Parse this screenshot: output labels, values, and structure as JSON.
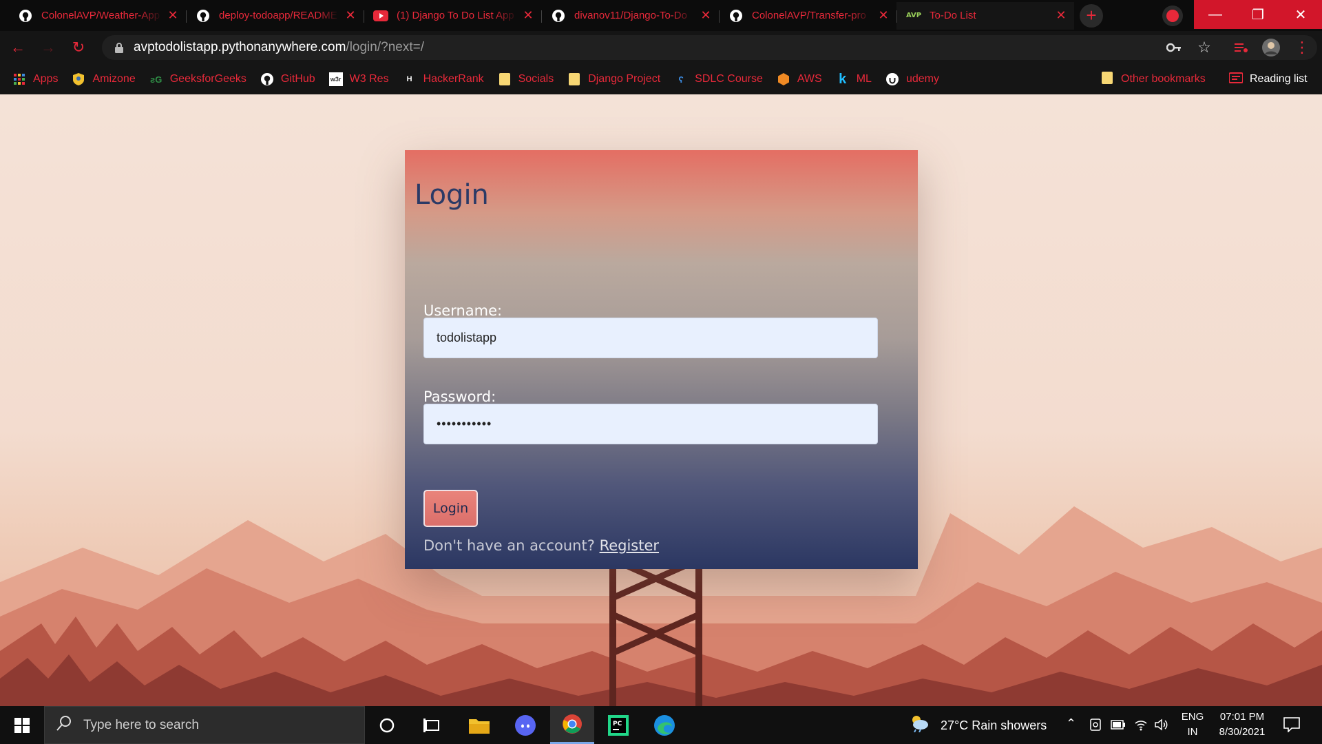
{
  "browser": {
    "tabs": [
      {
        "title": "ColonelAVP/Weather-App",
        "favicon": "github-icon"
      },
      {
        "title": "deploy-todoapp/README",
        "favicon": "github-icon"
      },
      {
        "title": "(1) Django To Do List App",
        "favicon": "youtube-icon"
      },
      {
        "title": "divanov11/Django-To-Do",
        "favicon": "github-icon"
      },
      {
        "title": "ColonelAVP/Transfer-pro",
        "favicon": "github-icon"
      },
      {
        "title": "To-Do List",
        "favicon": "avp-icon",
        "favicon_text": "AVP",
        "active": true
      }
    ],
    "url": {
      "host": "avptodolistapp.pythonanywhere.com",
      "path": "/login/?next=/"
    },
    "bookmarks": [
      {
        "label": "Apps",
        "icon": "apps-grid-icon"
      },
      {
        "label": "Amizone",
        "icon": "amizone-icon"
      },
      {
        "label": "GeeksforGeeks",
        "icon": "gfg-icon"
      },
      {
        "label": "GitHub",
        "icon": "github-icon"
      },
      {
        "label": "W3 Res",
        "icon": "w3res-icon"
      },
      {
        "label": "HackerRank",
        "icon": "hackerrank-icon"
      },
      {
        "label": "Socials",
        "icon": "folder-icon"
      },
      {
        "label": "Django Project",
        "icon": "folder-icon"
      },
      {
        "label": "SDLC Course",
        "icon": "sdlc-icon"
      },
      {
        "label": "AWS",
        "icon": "aws-icon"
      },
      {
        "label": "ML",
        "icon": "kaggle-icon"
      },
      {
        "label": "udemy",
        "icon": "udemy-icon"
      }
    ],
    "other_bookmarks": "Other bookmarks",
    "reading_list": "Reading list",
    "accent_color": "#e8293a"
  },
  "login": {
    "title": "Login",
    "username_label": "Username:",
    "username_value": "todolistapp",
    "password_label": "Password:",
    "password_value": "•••••••••••",
    "submit_label": "Login",
    "no_account_text": "Don't have an account?",
    "register_link": "Register"
  },
  "taskbar": {
    "search_placeholder": "Type here to search",
    "weather": "27°C  Rain showers",
    "lang_top": "ENG",
    "lang_bottom": "IN",
    "time": "07:01 PM",
    "date": "8/30/2021"
  }
}
